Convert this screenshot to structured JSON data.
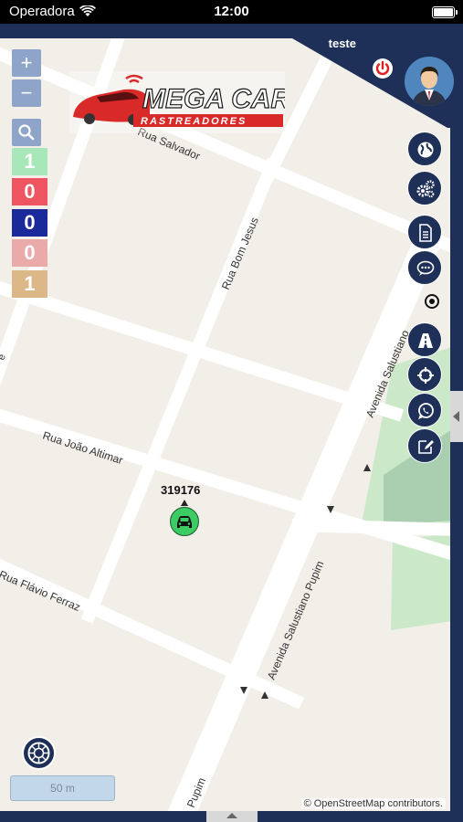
{
  "status_bar": {
    "carrier": "Operadora",
    "time": "12:00"
  },
  "header": {
    "user_name": "teste"
  },
  "logo": {
    "brand": "MEGA CAR",
    "tagline": "RASTREADORES"
  },
  "zoom": {
    "in_label": "+",
    "out_label": "−"
  },
  "counters": [
    {
      "value": "1",
      "color": "#a8e8b8"
    },
    {
      "value": "0",
      "color": "#ee5560"
    },
    {
      "value": "0",
      "color": "#1a2a9a"
    },
    {
      "value": "0",
      "color": "#eaaaaa"
    },
    {
      "value": "1",
      "color": "#dcb888"
    }
  ],
  "right_toolbar": [
    "globe-icon",
    "gears-icon",
    "document-icon",
    "chat-icon",
    "road-icon",
    "crosshair-icon",
    "whatsapp-icon",
    "edit-icon"
  ],
  "map": {
    "streets": [
      "Rua Salvador",
      "Rua Bom Jesus",
      "Avenida Salustiano",
      "Rua João Altimar",
      "Rua Flávio Ferraz",
      "Avenida Salustiano Pupim",
      "Pupim"
    ],
    "vehicle_id": "319176",
    "scale_label": "50 m",
    "attribution": "© OpenStreetMap contributors."
  },
  "colors": {
    "navy": "#1e2f58",
    "vehicle_green": "#3dcc63",
    "power_red": "#e02020"
  }
}
